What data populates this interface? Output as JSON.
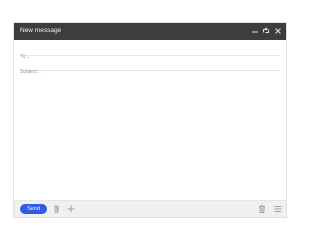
{
  "window": {
    "title": "New message",
    "controls": {
      "minimize": "minimize-icon",
      "restore": "restore-icon",
      "close": "close-icon"
    }
  },
  "fields": {
    "to_placeholder": "To...",
    "to_value": "",
    "subject_placeholder": "Subject...",
    "subject_value": "",
    "body_value": ""
  },
  "toolbar": {
    "send_label": "Send",
    "icons": [
      "paperclip-icon",
      "plus-icon",
      "trash-icon",
      "menu-icon"
    ]
  },
  "colors": {
    "titlebar": "#3b3d40",
    "send_button": "#2f5be8",
    "bottombar": "#eef0f1"
  }
}
